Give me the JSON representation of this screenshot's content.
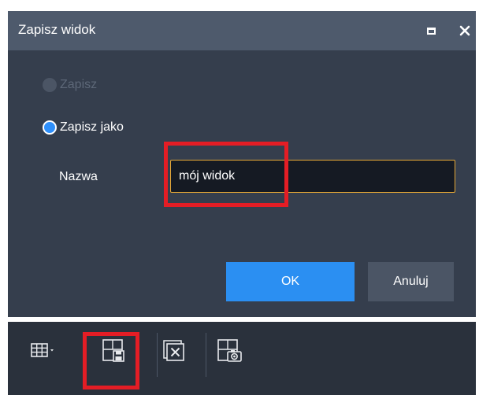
{
  "dialog": {
    "title": "Zapisz widok",
    "window_controls": [
      "maximize-icon",
      "close-icon"
    ],
    "options": [
      {
        "label": "Zapisz",
        "selected": false,
        "enabled": false
      },
      {
        "label": "Zapisz jako",
        "selected": true,
        "enabled": true
      }
    ],
    "name_label": "Nazwa",
    "name_value": "mój widok",
    "ok_label": "OK",
    "cancel_label": "Anuluj"
  },
  "toolbar": {
    "items": [
      "layout-grid-icon",
      "save-view-icon",
      "close-view-icon",
      "snapshot-icon"
    ]
  },
  "colors": {
    "accent": "#2b8ff2",
    "input_border": "#e5a736",
    "highlight": "#e41d25",
    "dialog_bg": "#353e4d",
    "titlebar_bg": "#4e5a6c"
  }
}
